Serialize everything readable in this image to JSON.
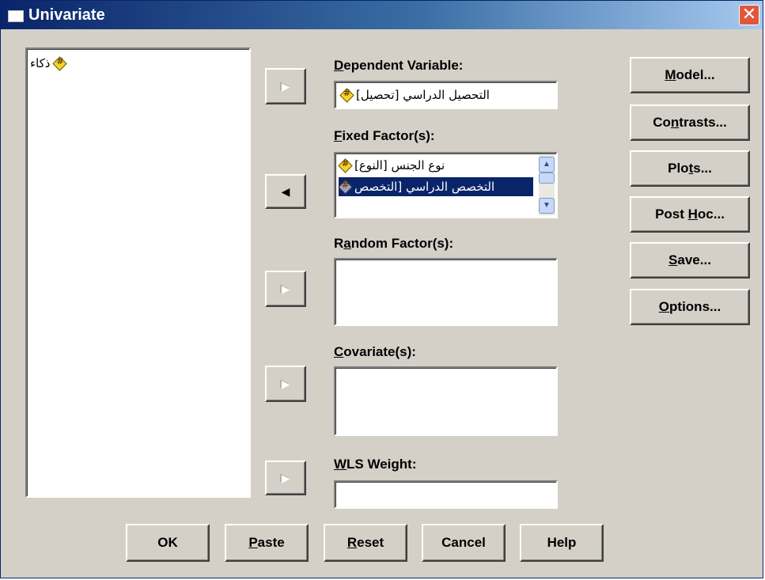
{
  "window": {
    "title": "Univariate",
    "close_glyph": "✕"
  },
  "source_list": {
    "items": [
      {
        "label": "ذكاء",
        "icon": "scale-variable-icon"
      }
    ]
  },
  "dependent": {
    "label_mnemonic": "D",
    "label_rest": "ependent Variable:",
    "value": "[التحصيل الدراسي [تحصيل",
    "arrow_glyph": "▶"
  },
  "fixed_factors": {
    "label_mnemonic": "F",
    "label_rest": "ixed Factor(s):",
    "arrow_glyph": "◀",
    "items": [
      {
        "label": "[نوع الجنس [النوع",
        "selected": false
      },
      {
        "label": "التخصص الدراسي [التخصص",
        "selected": true
      }
    ],
    "scroll_up_glyph": "▲",
    "scroll_down_glyph": "▼"
  },
  "random_factors": {
    "label_pre": "R",
    "label_mnemonic": "a",
    "label_rest": "ndom Factor(s):",
    "arrow_glyph": "▶"
  },
  "covariates": {
    "label_mnemonic": "C",
    "label_rest": "ovariate(s):",
    "arrow_glyph": "▶"
  },
  "wls": {
    "label_mnemonic": "W",
    "label_rest": "LS Weight:",
    "arrow_glyph": "▶"
  },
  "side_buttons": {
    "model": {
      "pre": "",
      "mn": "M",
      "post": "odel..."
    },
    "contrasts": {
      "pre": "Co",
      "mn": "n",
      "post": "trasts..."
    },
    "plots": {
      "pre": "Plo",
      "mn": "t",
      "post": "s..."
    },
    "post_hoc": {
      "pre": "Post ",
      "mn": "H",
      "post": "oc..."
    },
    "save": {
      "pre": "",
      "mn": "S",
      "post": "ave..."
    },
    "options": {
      "pre": "",
      "mn": "O",
      "post": "ptions..."
    }
  },
  "bottom_buttons": {
    "ok": "OK",
    "paste": {
      "mn": "P",
      "post": "aste"
    },
    "reset": {
      "mn": "R",
      "post": "eset"
    },
    "cancel": "Cancel",
    "help": "Help"
  }
}
